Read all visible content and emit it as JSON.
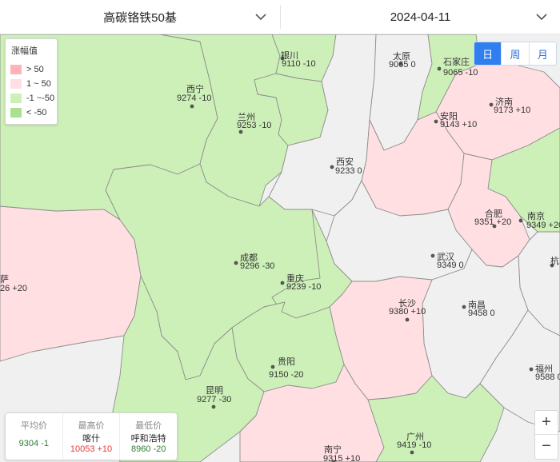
{
  "header": {
    "product": "高碳铬铁50基",
    "date": "2024-04-11"
  },
  "legend": {
    "title": "涨幅值",
    "items": [
      {
        "label": "> 50",
        "color": "#ffb3b8"
      },
      {
        "label": "1 ~ 50",
        "color": "#ffdfe2"
      },
      {
        "label": "-1 ~-50",
        "color": "#cdf0b8"
      },
      {
        "label": "< -50",
        "color": "#a9e190"
      }
    ]
  },
  "period": {
    "options": [
      "日",
      "周",
      "月"
    ],
    "active": "日"
  },
  "summary": {
    "avg_label": "平均价",
    "avg_value": "9304 -1",
    "high_label": "最高价",
    "high_city": "喀什",
    "high_value": "10053 +10",
    "low_label": "最低价",
    "low_city": "呼和浩特",
    "low_value": "8960 -20"
  },
  "cities": [
    {
      "name": "银川",
      "value": "9110 -10"
    },
    {
      "name": "太原",
      "value": "9065 0"
    },
    {
      "name": "石家庄",
      "value": "9065 -10"
    },
    {
      "name": "西宁",
      "value": "9274 -10"
    },
    {
      "name": "兰州",
      "value": "9253 -10"
    },
    {
      "name": "济南",
      "value": "9173 +10"
    },
    {
      "name": "安阳",
      "value": "9143 +10"
    },
    {
      "name": "西安",
      "value": "9233 0"
    },
    {
      "name": "合肥",
      "value": "9351 +20"
    },
    {
      "name": "南京",
      "value": "9349 +20"
    },
    {
      "name": "杭",
      "value": ""
    },
    {
      "name": "成都",
      "value": "9296 -30"
    },
    {
      "name": "武汉",
      "value": "9349 0"
    },
    {
      "name": "重庆",
      "value": "9239 -10"
    },
    {
      "name": "萨",
      "value": "26 +20"
    },
    {
      "name": "长沙",
      "value": "9380 +10"
    },
    {
      "name": "南昌",
      "value": "9458 0"
    },
    {
      "name": "贵阳",
      "value": "9150 -20"
    },
    {
      "name": "福州",
      "value": "9588 0"
    },
    {
      "name": "昆明",
      "value": "9277 -30"
    },
    {
      "name": "广州",
      "value": "9419 -10"
    },
    {
      "name": "南宁",
      "value": "9315 +10"
    }
  ],
  "zoom": {
    "in": "+",
    "out": "−"
  },
  "colors": {
    "up_strong": "#ffb3b8",
    "up": "#ffdfe2",
    "down": "#cdf0b8",
    "flat": "#f0f0f0",
    "accent": "#2f7ff0",
    "positive_text": "#e53935",
    "negative_text": "#2e7d32"
  }
}
